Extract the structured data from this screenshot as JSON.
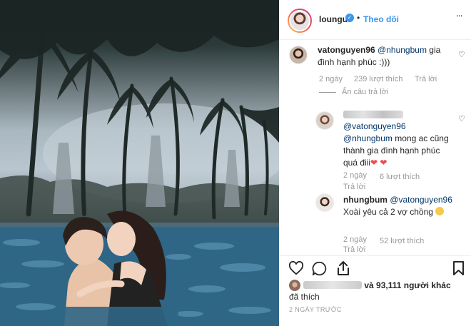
{
  "post": {
    "username": "loungu",
    "follow_label": "Theo dõi",
    "more_label": "...",
    "verified_label": "✓"
  },
  "comments": [
    {
      "username": "vatonguyen96",
      "mention": "@nhungbum",
      "text_before": "gia",
      "text_line2": "đình hạnh phúc :)))",
      "time": "2 ngày",
      "likes": "239 lượt thích",
      "reply": "Trả lời",
      "hide_replies": "Ẩn câu trả lời"
    },
    {
      "username": "",
      "mention1": "@vatonguyen96",
      "mention2": "@nhungbum",
      "line2_rest": "mong ac cũng",
      "line3": "thành gia đình hạnh phúc",
      "line4": "quá điii",
      "hearts": "❤ ❤",
      "time": "2 ngày",
      "likes": "6 lượt thích",
      "reply": "Trả lời"
    },
    {
      "username": "nhungbum",
      "mention": "@vatonguyen96",
      "line2": "Xoài yêu cả 2 vợ chồng",
      "time": "2 ngày",
      "likes": "52 lượt thích",
      "reply": "Trả lời"
    }
  ],
  "actions": {
    "likes_text": "và 93,111 người khác",
    "likes_text2": "đã thích",
    "date": "2 NGÀY TRƯỚC"
  },
  "icons": [
    "verified-icon",
    "more-icon",
    "heart-icon",
    "comment-icon",
    "share-icon",
    "bookmark-icon"
  ],
  "colors": {
    "link": "#3897f0",
    "mention": "#003569",
    "muted": "#999999",
    "heart": "#ed4956"
  }
}
